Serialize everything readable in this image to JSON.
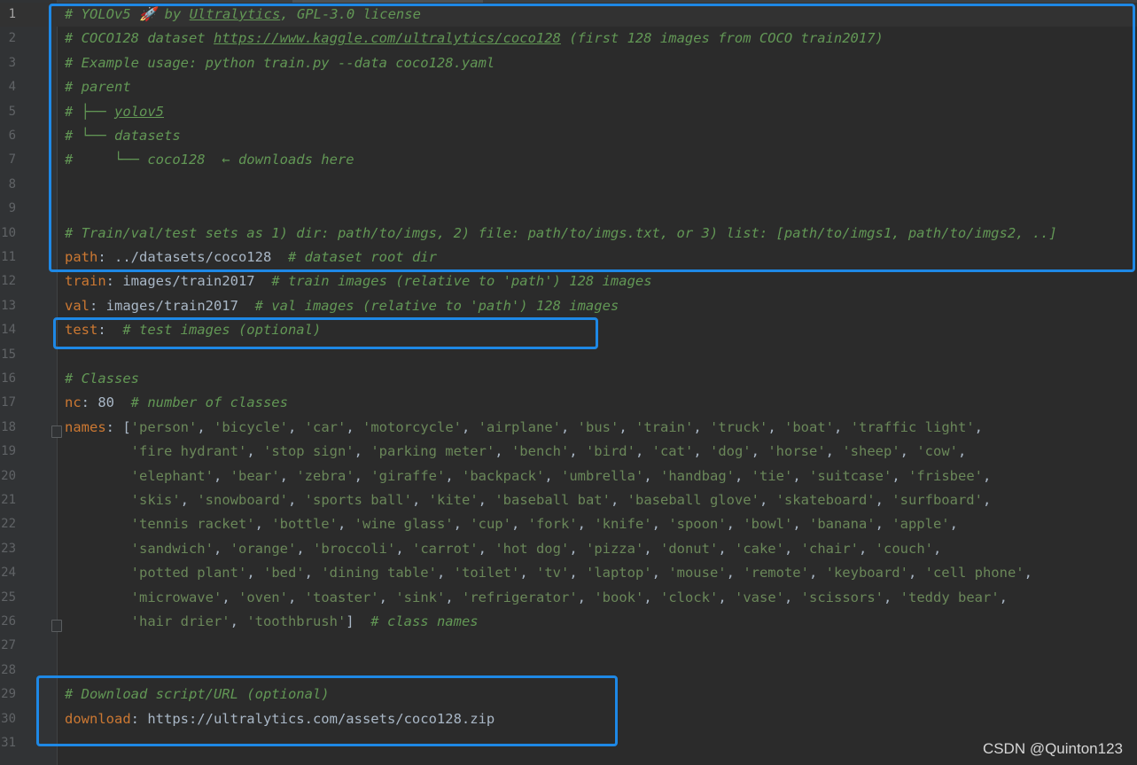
{
  "editor": {
    "lines": [
      {
        "n": "1",
        "segs": [
          {
            "c": "comment",
            "t": "# YOLOv5 🚀 by "
          },
          {
            "c": "link",
            "t": "Ultralytics"
          },
          {
            "c": "comment",
            "t": ", GPL-3.0 license"
          }
        ]
      },
      {
        "n": "2",
        "segs": [
          {
            "c": "comment",
            "t": "# COCO128 dataset "
          },
          {
            "c": "link",
            "t": "https://www.kaggle.com/ultralytics/coco128"
          },
          {
            "c": "comment",
            "t": " (first 128 images from COCO train2017)"
          }
        ]
      },
      {
        "n": "3",
        "segs": [
          {
            "c": "comment",
            "t": "# Example usage: python train.py --data coco128.yaml"
          }
        ]
      },
      {
        "n": "4",
        "segs": [
          {
            "c": "comment",
            "t": "# parent"
          }
        ]
      },
      {
        "n": "5",
        "segs": [
          {
            "c": "comment",
            "t": "# ├── "
          },
          {
            "c": "link",
            "t": "yolov5"
          }
        ]
      },
      {
        "n": "6",
        "segs": [
          {
            "c": "comment",
            "t": "# └── datasets"
          }
        ]
      },
      {
        "n": "7",
        "segs": [
          {
            "c": "comment",
            "t": "#     └── coco128  ← downloads here"
          }
        ]
      },
      {
        "n": "8",
        "segs": []
      },
      {
        "n": "9",
        "segs": []
      },
      {
        "n": "10",
        "segs": [
          {
            "c": "comment",
            "t": "# Train/val/test sets as 1) dir: path/to/imgs, 2) file: path/to/imgs.txt, or 3) list: [path/to/imgs1, path/to/imgs2, ..]"
          }
        ]
      },
      {
        "n": "11",
        "segs": [
          {
            "c": "key",
            "t": "path"
          },
          {
            "c": "plain",
            "t": ": ../datasets/coco128  "
          },
          {
            "c": "comment",
            "t": "# dataset root dir"
          }
        ]
      },
      {
        "n": "12",
        "segs": [
          {
            "c": "key",
            "t": "train"
          },
          {
            "c": "plain",
            "t": ": images/train2017  "
          },
          {
            "c": "comment",
            "t": "# train images (relative to 'path') 128 images"
          }
        ]
      },
      {
        "n": "13",
        "segs": [
          {
            "c": "key",
            "t": "val"
          },
          {
            "c": "plain",
            "t": ": images/train2017  "
          },
          {
            "c": "comment",
            "t": "# val images (relative to 'path') 128 images"
          }
        ]
      },
      {
        "n": "14",
        "segs": [
          {
            "c": "key",
            "t": "test"
          },
          {
            "c": "plain",
            "t": ":  "
          },
          {
            "c": "comment",
            "t": "# test images (optional)"
          }
        ]
      },
      {
        "n": "15",
        "segs": []
      },
      {
        "n": "16",
        "segs": [
          {
            "c": "comment",
            "t": "# Classes"
          }
        ]
      },
      {
        "n": "17",
        "segs": [
          {
            "c": "key",
            "t": "nc"
          },
          {
            "c": "plain",
            "t": ": 80  "
          },
          {
            "c": "comment",
            "t": "# number of classes"
          }
        ]
      },
      {
        "n": "18",
        "segs": [
          {
            "c": "key",
            "t": "names"
          },
          {
            "c": "plain",
            "t": ": ["
          },
          {
            "c": "str",
            "t": "'person'"
          },
          {
            "c": "plain",
            "t": ", "
          },
          {
            "c": "str",
            "t": "'bicycle'"
          },
          {
            "c": "plain",
            "t": ", "
          },
          {
            "c": "str",
            "t": "'car'"
          },
          {
            "c": "plain",
            "t": ", "
          },
          {
            "c": "str",
            "t": "'motorcycle'"
          },
          {
            "c": "plain",
            "t": ", "
          },
          {
            "c": "str",
            "t": "'airplane'"
          },
          {
            "c": "plain",
            "t": ", "
          },
          {
            "c": "str",
            "t": "'bus'"
          },
          {
            "c": "plain",
            "t": ", "
          },
          {
            "c": "str",
            "t": "'train'"
          },
          {
            "c": "plain",
            "t": ", "
          },
          {
            "c": "str",
            "t": "'truck'"
          },
          {
            "c": "plain",
            "t": ", "
          },
          {
            "c": "str",
            "t": "'boat'"
          },
          {
            "c": "plain",
            "t": ", "
          },
          {
            "c": "str",
            "t": "'traffic light'"
          },
          {
            "c": "plain",
            "t": ","
          }
        ]
      },
      {
        "n": "19",
        "segs": [
          {
            "c": "plain",
            "t": "        "
          },
          {
            "c": "str",
            "t": "'fire hydrant'"
          },
          {
            "c": "plain",
            "t": ", "
          },
          {
            "c": "str",
            "t": "'stop sign'"
          },
          {
            "c": "plain",
            "t": ", "
          },
          {
            "c": "str",
            "t": "'parking meter'"
          },
          {
            "c": "plain",
            "t": ", "
          },
          {
            "c": "str",
            "t": "'bench'"
          },
          {
            "c": "plain",
            "t": ", "
          },
          {
            "c": "str",
            "t": "'bird'"
          },
          {
            "c": "plain",
            "t": ", "
          },
          {
            "c": "str",
            "t": "'cat'"
          },
          {
            "c": "plain",
            "t": ", "
          },
          {
            "c": "str",
            "t": "'dog'"
          },
          {
            "c": "plain",
            "t": ", "
          },
          {
            "c": "str",
            "t": "'horse'"
          },
          {
            "c": "plain",
            "t": ", "
          },
          {
            "c": "str",
            "t": "'sheep'"
          },
          {
            "c": "plain",
            "t": ", "
          },
          {
            "c": "str",
            "t": "'cow'"
          },
          {
            "c": "plain",
            "t": ","
          }
        ]
      },
      {
        "n": "20",
        "segs": [
          {
            "c": "plain",
            "t": "        "
          },
          {
            "c": "str",
            "t": "'elephant'"
          },
          {
            "c": "plain",
            "t": ", "
          },
          {
            "c": "str",
            "t": "'bear'"
          },
          {
            "c": "plain",
            "t": ", "
          },
          {
            "c": "str",
            "t": "'zebra'"
          },
          {
            "c": "plain",
            "t": ", "
          },
          {
            "c": "str",
            "t": "'giraffe'"
          },
          {
            "c": "plain",
            "t": ", "
          },
          {
            "c": "str",
            "t": "'backpack'"
          },
          {
            "c": "plain",
            "t": ", "
          },
          {
            "c": "str",
            "t": "'umbrella'"
          },
          {
            "c": "plain",
            "t": ", "
          },
          {
            "c": "str",
            "t": "'handbag'"
          },
          {
            "c": "plain",
            "t": ", "
          },
          {
            "c": "str",
            "t": "'tie'"
          },
          {
            "c": "plain",
            "t": ", "
          },
          {
            "c": "str",
            "t": "'suitcase'"
          },
          {
            "c": "plain",
            "t": ", "
          },
          {
            "c": "str",
            "t": "'frisbee'"
          },
          {
            "c": "plain",
            "t": ","
          }
        ]
      },
      {
        "n": "21",
        "segs": [
          {
            "c": "plain",
            "t": "        "
          },
          {
            "c": "str",
            "t": "'skis'"
          },
          {
            "c": "plain",
            "t": ", "
          },
          {
            "c": "str",
            "t": "'snowboard'"
          },
          {
            "c": "plain",
            "t": ", "
          },
          {
            "c": "str",
            "t": "'sports ball'"
          },
          {
            "c": "plain",
            "t": ", "
          },
          {
            "c": "str",
            "t": "'kite'"
          },
          {
            "c": "plain",
            "t": ", "
          },
          {
            "c": "str",
            "t": "'baseball bat'"
          },
          {
            "c": "plain",
            "t": ", "
          },
          {
            "c": "str",
            "t": "'baseball glove'"
          },
          {
            "c": "plain",
            "t": ", "
          },
          {
            "c": "str",
            "t": "'skateboard'"
          },
          {
            "c": "plain",
            "t": ", "
          },
          {
            "c": "str",
            "t": "'surfboard'"
          },
          {
            "c": "plain",
            "t": ","
          }
        ]
      },
      {
        "n": "22",
        "segs": [
          {
            "c": "plain",
            "t": "        "
          },
          {
            "c": "str",
            "t": "'tennis racket'"
          },
          {
            "c": "plain",
            "t": ", "
          },
          {
            "c": "str",
            "t": "'bottle'"
          },
          {
            "c": "plain",
            "t": ", "
          },
          {
            "c": "str",
            "t": "'wine glass'"
          },
          {
            "c": "plain",
            "t": ", "
          },
          {
            "c": "str",
            "t": "'cup'"
          },
          {
            "c": "plain",
            "t": ", "
          },
          {
            "c": "str",
            "t": "'fork'"
          },
          {
            "c": "plain",
            "t": ", "
          },
          {
            "c": "str",
            "t": "'knife'"
          },
          {
            "c": "plain",
            "t": ", "
          },
          {
            "c": "str",
            "t": "'spoon'"
          },
          {
            "c": "plain",
            "t": ", "
          },
          {
            "c": "str",
            "t": "'bowl'"
          },
          {
            "c": "plain",
            "t": ", "
          },
          {
            "c": "str",
            "t": "'banana'"
          },
          {
            "c": "plain",
            "t": ", "
          },
          {
            "c": "str",
            "t": "'apple'"
          },
          {
            "c": "plain",
            "t": ","
          }
        ]
      },
      {
        "n": "23",
        "segs": [
          {
            "c": "plain",
            "t": "        "
          },
          {
            "c": "str",
            "t": "'sandwich'"
          },
          {
            "c": "plain",
            "t": ", "
          },
          {
            "c": "str",
            "t": "'orange'"
          },
          {
            "c": "plain",
            "t": ", "
          },
          {
            "c": "str",
            "t": "'broccoli'"
          },
          {
            "c": "plain",
            "t": ", "
          },
          {
            "c": "str",
            "t": "'carrot'"
          },
          {
            "c": "plain",
            "t": ", "
          },
          {
            "c": "str",
            "t": "'hot dog'"
          },
          {
            "c": "plain",
            "t": ", "
          },
          {
            "c": "str",
            "t": "'pizza'"
          },
          {
            "c": "plain",
            "t": ", "
          },
          {
            "c": "str",
            "t": "'donut'"
          },
          {
            "c": "plain",
            "t": ", "
          },
          {
            "c": "str",
            "t": "'cake'"
          },
          {
            "c": "plain",
            "t": ", "
          },
          {
            "c": "str",
            "t": "'chair'"
          },
          {
            "c": "plain",
            "t": ", "
          },
          {
            "c": "str",
            "t": "'couch'"
          },
          {
            "c": "plain",
            "t": ","
          }
        ]
      },
      {
        "n": "24",
        "segs": [
          {
            "c": "plain",
            "t": "        "
          },
          {
            "c": "str",
            "t": "'potted plant'"
          },
          {
            "c": "plain",
            "t": ", "
          },
          {
            "c": "str",
            "t": "'bed'"
          },
          {
            "c": "plain",
            "t": ", "
          },
          {
            "c": "str",
            "t": "'dining table'"
          },
          {
            "c": "plain",
            "t": ", "
          },
          {
            "c": "str",
            "t": "'toilet'"
          },
          {
            "c": "plain",
            "t": ", "
          },
          {
            "c": "str",
            "t": "'tv'"
          },
          {
            "c": "plain",
            "t": ", "
          },
          {
            "c": "str",
            "t": "'laptop'"
          },
          {
            "c": "plain",
            "t": ", "
          },
          {
            "c": "str",
            "t": "'mouse'"
          },
          {
            "c": "plain",
            "t": ", "
          },
          {
            "c": "str",
            "t": "'remote'"
          },
          {
            "c": "plain",
            "t": ", "
          },
          {
            "c": "str",
            "t": "'keyboard'"
          },
          {
            "c": "plain",
            "t": ", "
          },
          {
            "c": "str",
            "t": "'cell phone'"
          },
          {
            "c": "plain",
            "t": ","
          }
        ]
      },
      {
        "n": "25",
        "segs": [
          {
            "c": "plain",
            "t": "        "
          },
          {
            "c": "str",
            "t": "'microwave'"
          },
          {
            "c": "plain",
            "t": ", "
          },
          {
            "c": "str",
            "t": "'oven'"
          },
          {
            "c": "plain",
            "t": ", "
          },
          {
            "c": "str",
            "t": "'toaster'"
          },
          {
            "c": "plain",
            "t": ", "
          },
          {
            "c": "str",
            "t": "'sink'"
          },
          {
            "c": "plain",
            "t": ", "
          },
          {
            "c": "str",
            "t": "'refrigerator'"
          },
          {
            "c": "plain",
            "t": ", "
          },
          {
            "c": "str",
            "t": "'book'"
          },
          {
            "c": "plain",
            "t": ", "
          },
          {
            "c": "str",
            "t": "'clock'"
          },
          {
            "c": "plain",
            "t": ", "
          },
          {
            "c": "str",
            "t": "'vase'"
          },
          {
            "c": "plain",
            "t": ", "
          },
          {
            "c": "str",
            "t": "'scissors'"
          },
          {
            "c": "plain",
            "t": ", "
          },
          {
            "c": "str",
            "t": "'teddy bear'"
          },
          {
            "c": "plain",
            "t": ","
          }
        ]
      },
      {
        "n": "26",
        "segs": [
          {
            "c": "plain",
            "t": "        "
          },
          {
            "c": "str",
            "t": "'hair drier'"
          },
          {
            "c": "plain",
            "t": ", "
          },
          {
            "c": "str",
            "t": "'toothbrush'"
          },
          {
            "c": "plain",
            "t": "]  "
          },
          {
            "c": "comment",
            "t": "# class names"
          }
        ]
      },
      {
        "n": "27",
        "segs": []
      },
      {
        "n": "28",
        "segs": []
      },
      {
        "n": "29",
        "segs": [
          {
            "c": "comment",
            "t": "# Download script/URL (optional)"
          }
        ]
      },
      {
        "n": "30",
        "segs": [
          {
            "c": "key",
            "t": "download"
          },
          {
            "c": "plain",
            "t": ": https://ultralytics.com/assets/coco128.zip"
          }
        ]
      },
      {
        "n": "31",
        "segs": []
      }
    ]
  },
  "watermark": "CSDN @Quinton123",
  "colors": {
    "background": "#2b2b2b",
    "comment": "#629755",
    "key": "#cc7832",
    "string": "#6a8759",
    "plain": "#a9b7c6",
    "highlight_box": "#1e88e5"
  }
}
